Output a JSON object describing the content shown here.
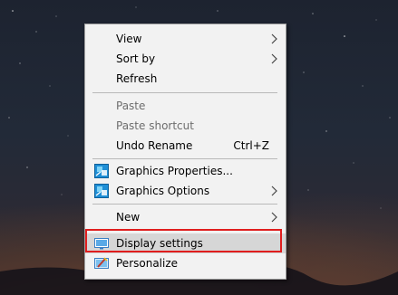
{
  "context_menu": {
    "items": [
      {
        "label": "View",
        "submenu": true,
        "disabled": false
      },
      {
        "label": "Sort by",
        "submenu": true,
        "disabled": false
      },
      {
        "label": "Refresh",
        "submenu": false,
        "disabled": false
      },
      {
        "label": "Paste",
        "submenu": false,
        "disabled": true
      },
      {
        "label": "Paste shortcut",
        "submenu": false,
        "disabled": true
      },
      {
        "label": "Undo Rename",
        "shortcut": "Ctrl+Z",
        "submenu": false,
        "disabled": false
      },
      {
        "label": "Graphics Properties...",
        "icon": "intel-graphics-icon",
        "submenu": false,
        "disabled": false
      },
      {
        "label": "Graphics Options",
        "icon": "intel-graphics-icon",
        "submenu": true,
        "disabled": false
      },
      {
        "label": "New",
        "submenu": true,
        "disabled": false
      },
      {
        "label": "Display settings",
        "icon": "display-icon",
        "submenu": false,
        "disabled": false,
        "highlighted": true
      },
      {
        "label": "Personalize",
        "icon": "personalize-icon",
        "submenu": false,
        "disabled": false
      }
    ]
  },
  "colors": {
    "highlight_box": "#e01e1e",
    "menu_background": "#f2f2f2",
    "hover_background": "#d6d6d6"
  }
}
